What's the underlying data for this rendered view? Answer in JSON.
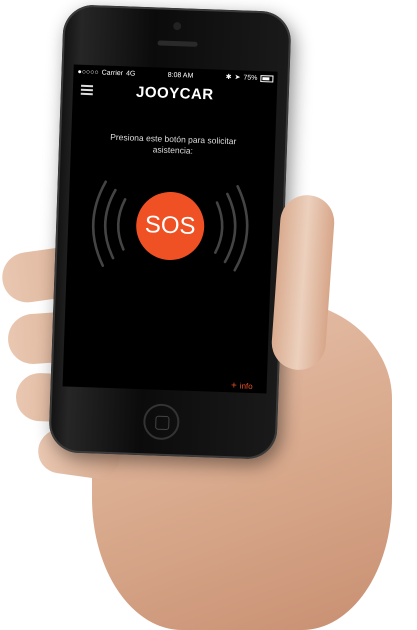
{
  "statusbar": {
    "carrier": "Carrier",
    "network": "4G",
    "time": "8:08 AM",
    "battery": "75%"
  },
  "header": {
    "logo_text": "JOOYCAR",
    "menu_icon": "hamburger-menu-icon"
  },
  "main": {
    "prompt": "Presiona este botón para solicitar asistencia:",
    "sos_label": "SOS",
    "info_label": "info",
    "info_icon": "plus-icon"
  },
  "colors": {
    "accent": "#ef5125",
    "screen_bg": "#000000"
  }
}
